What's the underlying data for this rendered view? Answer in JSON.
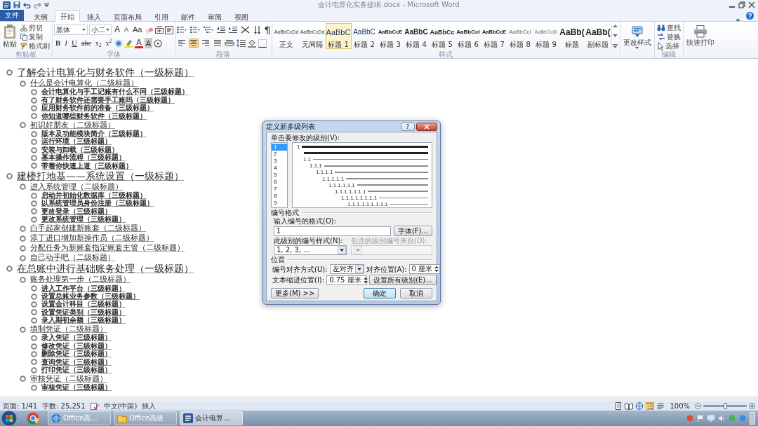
{
  "window": {
    "title": "会计电算化实务提纲.docx - Microsoft Word"
  },
  "ribbon": {
    "tabs": [
      {
        "label": "文件",
        "kind": "backstage",
        "selected": false
      },
      {
        "label": "大纲",
        "kind": "tab",
        "selected": false
      },
      {
        "label": "开始",
        "kind": "tab",
        "selected": true
      },
      {
        "label": "插入",
        "kind": "tab",
        "selected": false
      },
      {
        "label": "页面布局",
        "kind": "tab",
        "selected": false
      },
      {
        "label": "引用",
        "kind": "tab",
        "selected": false
      },
      {
        "label": "邮件",
        "kind": "tab",
        "selected": false
      },
      {
        "label": "审阅",
        "kind": "tab",
        "selected": false
      },
      {
        "label": "视图",
        "kind": "tab",
        "selected": false
      }
    ],
    "clipboard": {
      "label": "剪贴板",
      "paste": "粘贴",
      "cut": "剪切",
      "copy": "复制",
      "format_painter": "格式刷"
    },
    "font": {
      "label": "字体",
      "name": "黑体",
      "size": "小二",
      "size_glyphs": [
        "A",
        "A",
        "Aa"
      ],
      "format_glyphs": [
        "B",
        "I",
        "U",
        "abc",
        "x$_{2}$",
        "x$^{2}$"
      ],
      "color_glyphs": [
        "A",
        "A"
      ]
    },
    "paragraph": {
      "label": "段落",
      "align_buttons": [
        {
          "kind": "left",
          "selected": false
        },
        {
          "kind": "center",
          "selected": true
        },
        {
          "kind": "right",
          "selected": false
        },
        {
          "kind": "justify",
          "selected": false
        },
        {
          "kind": "distributed",
          "selected": false
        }
      ]
    },
    "styles": {
      "label": "样式",
      "items": [
        {
          "preview": "AaBbCcDd",
          "name": "正文",
          "selected": false
        },
        {
          "preview": "AaBbCcDd",
          "name": "无间隔",
          "selected": false
        },
        {
          "preview": "AaBbC",
          "name": "标题 1",
          "selected": true
        },
        {
          "preview": "AaBbC",
          "name": "标题 2",
          "selected": false
        },
        {
          "preview": "AaBbCcE",
          "name": "标题 3",
          "selected": false
        },
        {
          "preview": "AaBbC",
          "name": "标题 4",
          "selected": false
        },
        {
          "preview": "AaBbCc",
          "name": "标题 5",
          "selected": false
        },
        {
          "preview": "AaBbCcI",
          "name": "标题 6",
          "selected": false
        },
        {
          "preview": "AaBbCcE",
          "name": "标题 7",
          "selected": false
        },
        {
          "preview": "AaBbCcI",
          "name": "标题 8",
          "selected": false
        },
        {
          "preview": "AaBbCcDi",
          "name": "标题 9",
          "selected": false
        },
        {
          "preview": "AaBb(",
          "name": "标题",
          "selected": false
        },
        {
          "preview": "AaBb(",
          "name": "副标题",
          "selected": false
        }
      ],
      "change_button": "更改样式"
    },
    "editing": {
      "label": "编辑",
      "find": "查找",
      "replace": "替换",
      "select": "选择"
    },
    "quick_print": {
      "button": "快速打印"
    }
  },
  "outline": [
    {
      "text": "了解会计电算化与财务软件（一级标题）",
      "children": [
        {
          "text": "什么是会计电算化（二级标题）",
          "children": [
            {
              "text": "会计电算化与手工记账有什么不同（三级标题）"
            },
            {
              "text": "有了财务软件还需要手工账吗（三级标题）"
            },
            {
              "text": "应用财务软件前的准备（三级标题）"
            },
            {
              "text": "你知道哪些财务软件（三级标题）"
            }
          ]
        },
        {
          "text": "初识好朋友（二级标题）",
          "children": [
            {
              "text": "版本及功能模块简介（三级标题）"
            },
            {
              "text": "运行环境（三级标题）"
            },
            {
              "text": "安装与卸载（三级标题）"
            },
            {
              "text": "基本操作流程（三级标题）"
            },
            {
              "text": "带着你快速上道（三级标题）"
            }
          ]
        }
      ]
    },
    {
      "text": "建楼打地基——系统设置（一级标题）",
      "children": [
        {
          "text": "进入系统管理（二级标题）",
          "children": [
            {
              "text": "启动并初始化数据库（三级标题）"
            },
            {
              "text": "以系统管理员身份注册（三级标题）"
            },
            {
              "text": "更改登录（三级标题）"
            },
            {
              "text": "更改系统管理（三级标题）"
            }
          ]
        },
        {
          "text": "白手起家创建新账套（二级标题）"
        },
        {
          "text": "添丁进口增加新操作员（二级标题）"
        },
        {
          "text": "分配任务为新账套指定账套主管（二级标题）"
        },
        {
          "text": "自己动手吧（二级标题）"
        }
      ]
    },
    {
      "text": "在总账中进行基础账务处理（一级标题）",
      "children": [
        {
          "text": "账务处理第一步（二级标题）",
          "children": [
            {
              "text": "进入工作平台（三级标题）"
            },
            {
              "text": "设置总账业务参数（三级标题）"
            },
            {
              "text": "设置会计科目（三级标题）"
            },
            {
              "text": "设置凭证类别（三级标题）"
            },
            {
              "text": "录入期初余额（三级标题）"
            }
          ]
        },
        {
          "text": "填制凭证（二级标题）",
          "children": [
            {
              "text": "录入凭证（三级标题）"
            },
            {
              "text": "修改凭证（三级标题）"
            },
            {
              "text": "删除凭证（三级标题）"
            },
            {
              "text": "查询凭证（三级标题）"
            },
            {
              "text": "打印凭证（三级标题）"
            }
          ]
        },
        {
          "text": "审核凭证（二级标题）",
          "children": [
            {
              "text": "审核凭证（三级标题）"
            }
          ]
        }
      ]
    }
  ],
  "dialog": {
    "title": "定义新多级列表",
    "help": "?",
    "level_label": "单击要修改的级别(V):",
    "levels": [
      {
        "label": "1",
        "selected": true
      },
      {
        "label": "2",
        "selected": false
      },
      {
        "label": "3",
        "selected": false
      },
      {
        "label": "4",
        "selected": false
      },
      {
        "label": "5",
        "selected": false
      },
      {
        "label": "6",
        "selected": false
      },
      {
        "label": "7",
        "selected": false
      },
      {
        "label": "8",
        "selected": false
      },
      {
        "label": "9",
        "selected": false
      }
    ],
    "preview_numbers": [
      "1",
      "1.1",
      "1.1.1",
      "1.1.1.1",
      "1.1.1.1.1",
      "1.1.1.1.1.1",
      "1.1.1.1.1.1.1",
      "1.1.1.1.1.1.1.1",
      "1.1.1.1.1.1.1.1.1"
    ],
    "format_section": "编号格式",
    "format_label": "输入编号的格式(O):",
    "format_value": "1",
    "font_button": "字体(F)...",
    "style_label": "此级别的编号样式(N):",
    "style_value": "1, 2, 3, ...",
    "include_label": "包含的级别编号来自(D):",
    "include_disabled": true,
    "position_section": "位置",
    "align_label": "编号对齐方式(U):",
    "align_value": "左对齐",
    "align_at_label": "对齐位置(A):",
    "align_at_value": "0 厘米",
    "indent_label": "文本缩进位置(I):",
    "indent_value": "0.75 厘米",
    "all_levels_button": "设置所有级别(E)...",
    "more_button": "更多(M) >>",
    "ok_button": "确定",
    "cancel_button": "取消"
  },
  "status_bar": {
    "page": "页面: 1/41",
    "words": "字数: 25,251",
    "language": "中文(中国)",
    "mode": "插入",
    "views": [
      {
        "kind": "print",
        "selected": false
      },
      {
        "kind": "reading",
        "selected": false
      },
      {
        "kind": "web",
        "selected": false
      },
      {
        "kind": "outline",
        "selected": true
      },
      {
        "kind": "draft",
        "selected": false
      }
    ],
    "zoom": {
      "reading": "100%",
      "level": 0.5
    }
  },
  "taskbar": {
    "buttons": [
      {
        "kind": "browser",
        "title": "Office高...",
        "selected": false
      },
      {
        "kind": "folder",
        "title": "Office高级",
        "selected": false
      },
      {
        "kind": "word",
        "title": "会计电算...",
        "selected": true
      }
    ]
  }
}
